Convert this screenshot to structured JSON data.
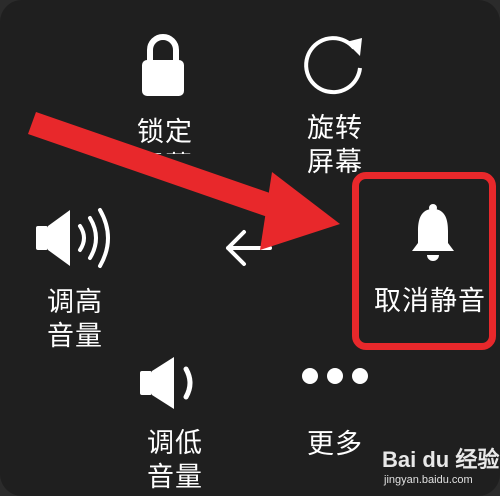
{
  "menu": {
    "lock_screen": {
      "line1": "锁定",
      "line2": "屏幕"
    },
    "rotate_screen": {
      "line1": "旋转",
      "line2": "屏幕"
    },
    "volume_up": {
      "line1": "调高",
      "line2": "音量"
    },
    "unmute": {
      "label": "取消静音"
    },
    "volume_down": {
      "line1": "调低",
      "line2": "音量"
    },
    "more": {
      "label": "更多"
    }
  },
  "watermark": {
    "logo": "Bai du 经验",
    "url": "jingyan.baidu.com"
  },
  "colors": {
    "panel_bg": "#1f1f1f",
    "icon_fg": "#ffffff",
    "annotation_red": "#e8282b"
  },
  "icons": {
    "lock": "lock-icon",
    "rotate": "rotate-icon",
    "volume_up": "volume-up-icon",
    "back": "back-arrow-icon",
    "bell": "bell-icon",
    "volume_down": "volume-down-icon",
    "more": "more-dots-icon"
  }
}
